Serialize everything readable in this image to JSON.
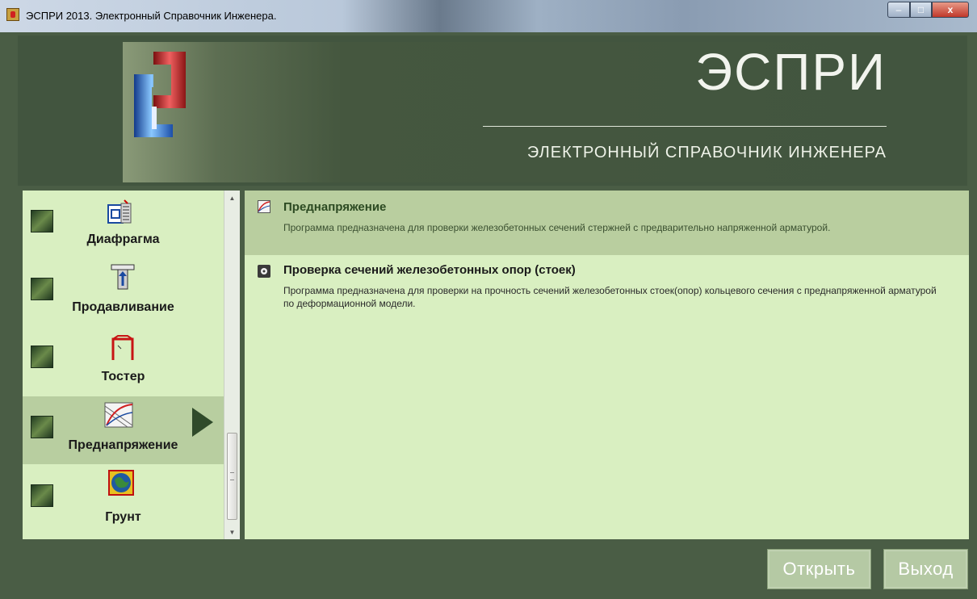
{
  "window": {
    "title": "ЭСПРИ 2013. Электронный Справочник Инженера.",
    "min_glyph": "‒",
    "max_glyph": "□",
    "close_glyph": "x"
  },
  "header": {
    "brand": "ЭСПРИ",
    "subtitle": "ЭЛЕКТРОННЫЙ СПРАВОЧНИК ИНЖЕНЕРА"
  },
  "sidebar": {
    "items": [
      {
        "label": "Диафрагма",
        "icon": "diaphragm-icon"
      },
      {
        "label": "Продавливание",
        "icon": "punching-icon"
      },
      {
        "label": "Тостер",
        "icon": "toster-icon"
      },
      {
        "label": "Преднапряжение",
        "icon": "prestress-icon",
        "active": true
      },
      {
        "label": "Грунт",
        "icon": "soil-icon"
      }
    ]
  },
  "programs": [
    {
      "title": "Преднапряжение",
      "description": "Программа предназначена для проверки железобетонных сечений стержней с  предварительно напряженной арматурой.",
      "icon": "prestress-small-icon",
      "selected": true
    },
    {
      "title": "Проверка сечений железобетонных опор (стоек)",
      "description": "Программа предназначена для проверки на прочность сечений железобетонных стоек(опор) кольцевого сечения с преднапряженной арматурой по деформационной модели.",
      "icon": "column-section-icon",
      "selected": false
    }
  ],
  "buttons": {
    "open": "Открыть",
    "exit": "Выход"
  },
  "colors": {
    "background": "#4a5d45",
    "panel": "#d9efc1",
    "selected": "#b9ce9f",
    "button": "#b5c9a4"
  }
}
